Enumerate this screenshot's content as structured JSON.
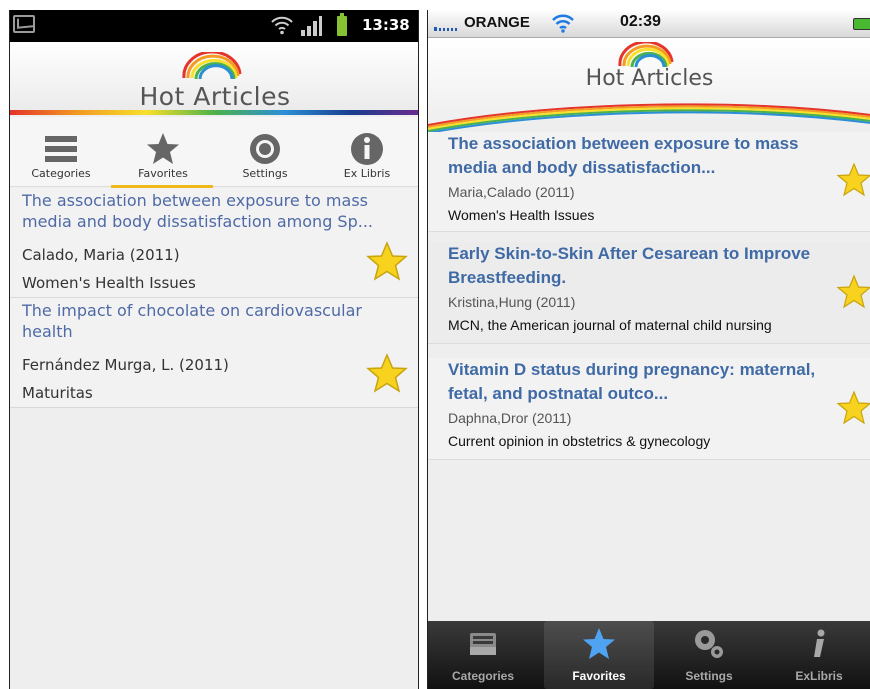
{
  "android": {
    "status": {
      "time": "13:38"
    },
    "header": {
      "title": "Hot Articles"
    },
    "tabs": [
      {
        "label": "Categories",
        "icon": "list-icon"
      },
      {
        "label": "Favorites",
        "icon": "star-icon"
      },
      {
        "label": "Settings",
        "icon": "gear-icon"
      },
      {
        "label": "Ex Libris",
        "icon": "info-icon"
      }
    ],
    "active_tab": "Favorites",
    "articles": [
      {
        "title": "The association between exposure to mass media and body dissatisfaction among Sp...",
        "author": "Calado, Maria (2011)",
        "journal": "Women's Health Issues"
      },
      {
        "title": "The impact of chocolate on cardiovascular health",
        "author": "Fernández Murga, L. (2011)",
        "journal": "Maturitas"
      }
    ]
  },
  "ios": {
    "status": {
      "carrier": "ORANGE",
      "time": "02:39"
    },
    "header": {
      "title": "Hot Articles"
    },
    "articles": [
      {
        "title": "The association between exposure to mass media and body dissatisfaction...",
        "author": "Maria,Calado (2011)",
        "journal": "Women's Health Issues"
      },
      {
        "title": "Early Skin-to-Skin After Cesarean to Improve Breastfeeding.",
        "author": "Kristina,Hung (2011)",
        "journal": "MCN, the American journal of maternal child nursing"
      },
      {
        "title": "Vitamin D status during pregnancy: maternal, fetal, and postnatal outco...",
        "author": "Daphna,Dror (2011)",
        "journal": "Current opinion in obstetrics & gynecology"
      }
    ],
    "tabs": [
      {
        "label": "Categories",
        "icon": "tray-icon"
      },
      {
        "label": "Favorites",
        "icon": "star-icon"
      },
      {
        "label": "Settings",
        "icon": "gears-icon"
      },
      {
        "label": "ExLibris",
        "icon": "info-icon"
      }
    ],
    "active_tab": "Favorites"
  },
  "colors": {
    "title_blue": "#4f6aa6",
    "favorites_indicator": "#f0b81b",
    "star_fill": "#f7d21f"
  }
}
